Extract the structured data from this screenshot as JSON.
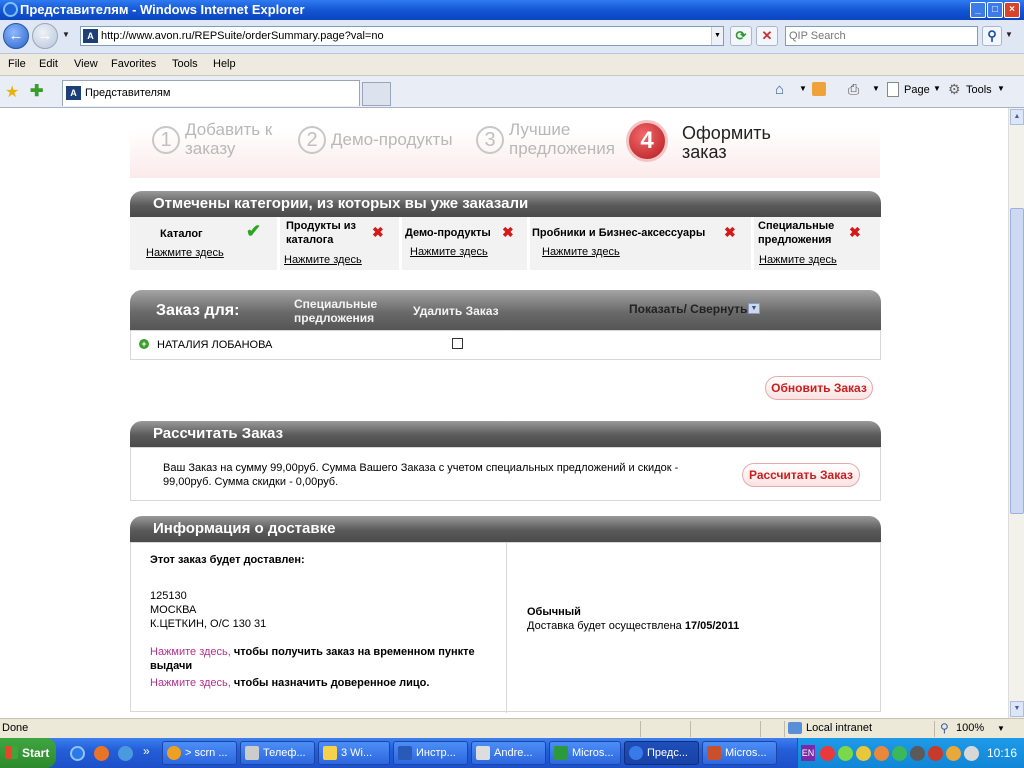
{
  "window": {
    "title": "Представителям - Windows Internet Explorer",
    "min": "_",
    "max": "□",
    "close": "×"
  },
  "address": {
    "url": "http://www.avon.ru/REPSuite/orderSummary.page?val=no",
    "search_placeholder": "QIP Search",
    "favicon": "A"
  },
  "menu": [
    "File",
    "Edit",
    "View",
    "Favorites",
    "Tools",
    "Help"
  ],
  "tab": {
    "label": "Представителям"
  },
  "toolbar": {
    "page": "Page",
    "tools": "Tools"
  },
  "steps": [
    {
      "num": "1",
      "label": "Добавить к заказу"
    },
    {
      "num": "2",
      "label": "Демо-продукты"
    },
    {
      "num": "3",
      "label": "Лучшие предложения"
    },
    {
      "num": "4",
      "label": "Оформить заказ"
    }
  ],
  "categories": {
    "title": "Отмечены категории, из которых вы уже заказали",
    "link": "Нажмите здесь",
    "items": [
      {
        "name": "Каталог",
        "done": true
      },
      {
        "name": "Продукты из каталога",
        "done": false
      },
      {
        "name": "Демо-продукты",
        "done": false
      },
      {
        "name": "Пробники и Бизнес-аксессуары",
        "done": false
      },
      {
        "name": "Специальные предложения",
        "done": false
      }
    ],
    "check": "✔",
    "cross": "✖"
  },
  "order": {
    "title": "Заказ для:",
    "col_special": "Специальные предложения",
    "col_delete": "Удалить Заказ",
    "col_toggle": "Показать/ Свернуть",
    "customer": "НАТАЛИЯ ЛОБАНОВА",
    "update_button": "Обновить Заказ"
  },
  "calc": {
    "title": "Рассчитать Заказ",
    "text": "Ваш Заказ на сумму 99,00руб. Сумма Вашего Заказа с учетом специальных предложений и скидок - 99,00руб. Сумма скидки - 0,00руб.",
    "button": "Рассчитать Заказ"
  },
  "delivery": {
    "title": "Информация о доставке",
    "heading": "Этот заказ будет доставлен:",
    "zip": "125130",
    "city": "МОСКВА",
    "street": "К.ЦЕТКИН, О/С 130 31",
    "link1": "Нажмите здесь,",
    "text1": " чтобы получить заказ на временном пункте выдачи",
    "link2": "Нажмите здесь,",
    "text2": " чтобы назначить доверенное лицо.",
    "type": "Обычный",
    "date_text": "Доставка будет осуществлена ",
    "date": "17/05/2011"
  },
  "status": {
    "left": "Done",
    "zone": "Local intranet",
    "zoom": "100%"
  },
  "taskbar": {
    "start": "Start",
    "items": [
      "> scrn ...",
      "Телеф...",
      "3 Wi...",
      "Инстр...",
      "Andre...",
      "Micros...",
      "Предс...",
      "Micros..."
    ],
    "lang": "EN",
    "clock": "10:16"
  },
  "colors": {
    "accent_red": "#c81e1e",
    "link_pink": "#b2308d",
    "check_green": "#2ca61f"
  }
}
